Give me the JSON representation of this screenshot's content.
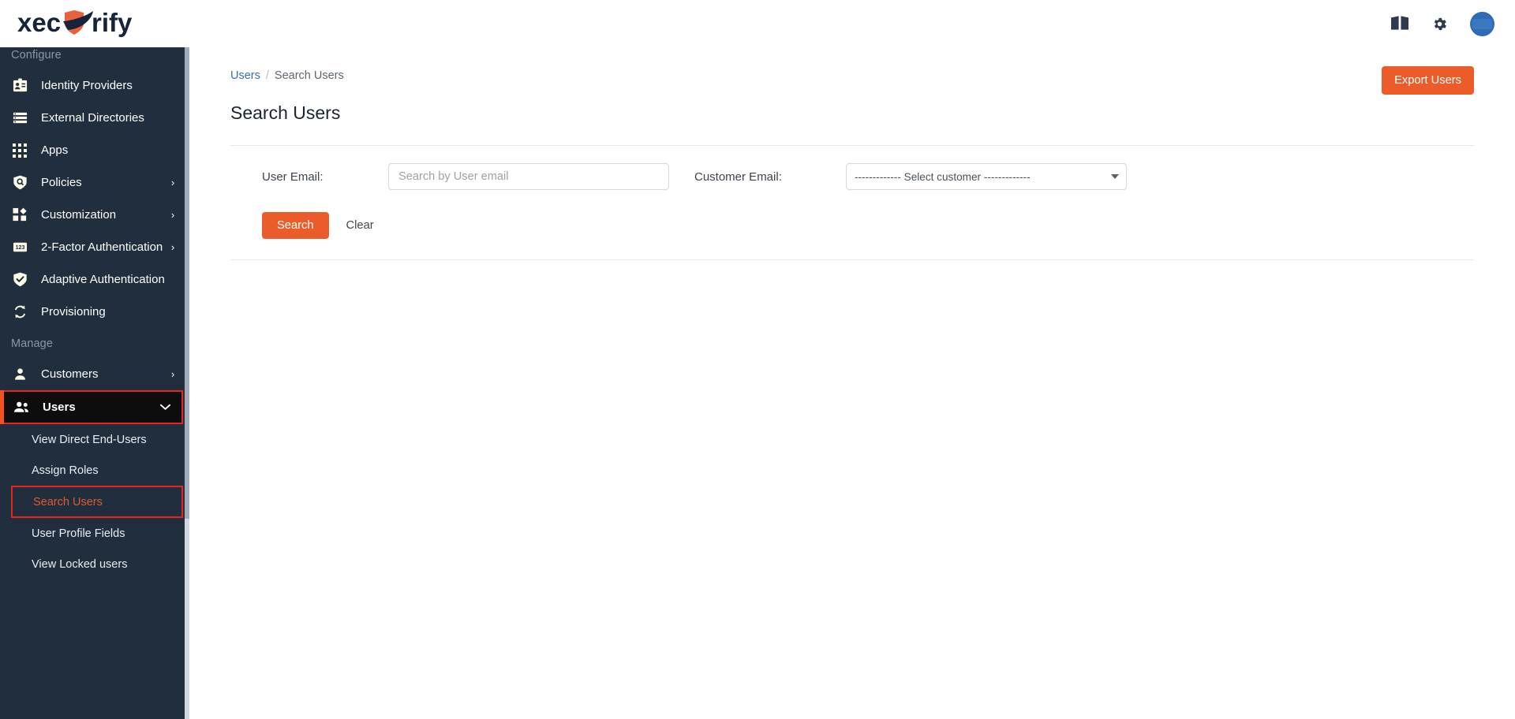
{
  "topbar": {
    "logo_text": "xecurify",
    "icons": [
      {
        "name": "book-icon",
        "label": "Documentation"
      },
      {
        "name": "gear-icon",
        "label": "Settings"
      },
      {
        "name": "avatar",
        "label": "Account",
        "color": "#2e6bb3"
      }
    ]
  },
  "sidebar": {
    "sections": [
      {
        "label": "Configure",
        "items": [
          {
            "label": "Identity Providers",
            "icon": "id-badge-icon",
            "chevron": ""
          },
          {
            "label": "External Directories",
            "icon": "list-icon",
            "chevron": ""
          },
          {
            "label": "Apps",
            "icon": "grid-icon",
            "chevron": ""
          },
          {
            "label": "Policies",
            "icon": "shield-search-icon",
            "chevron": "›"
          },
          {
            "label": "Customization",
            "icon": "blocks-icon",
            "chevron": "›"
          },
          {
            "label": "2-Factor Authentication",
            "icon": "123-icon",
            "chevron": "›"
          },
          {
            "label": "Adaptive Authentication",
            "icon": "shield-check-icon",
            "chevron": ""
          },
          {
            "label": "Provisioning",
            "icon": "sync-icon",
            "chevron": ""
          }
        ]
      },
      {
        "label": "Manage",
        "items": [
          {
            "label": "Customers",
            "icon": "user-icon",
            "chevron": "›"
          },
          {
            "label": "Users",
            "icon": "users-icon",
            "chevron": "⌄",
            "active": true
          }
        ]
      }
    ],
    "subitems": [
      {
        "label": "View Direct End-Users",
        "selected": false
      },
      {
        "label": "Assign Roles",
        "selected": false
      },
      {
        "label": "Search Users",
        "selected": true
      },
      {
        "label": "User Profile Fields",
        "selected": false
      },
      {
        "label": "View Locked users",
        "selected": false
      }
    ],
    "colors": {
      "background": "#202e3d",
      "active_background": "#0d0d0d",
      "highlight_border": "#e8241b",
      "accent_bar": "#f4511e",
      "selected_text": "#e05a2b"
    }
  },
  "main": {
    "breadcrumb": {
      "parent": "Users",
      "separator": "/",
      "current": "Search Users"
    },
    "page_title": "Search Users",
    "export_button": "Export Users",
    "form": {
      "user_email_label": "User Email:",
      "user_email_value": "",
      "user_email_placeholder": "Search by User email",
      "customer_email_label": "Customer Email:",
      "customer_select_value": "------------- Select customer -------------",
      "search_button": "Search",
      "clear_button": "Clear"
    },
    "colors": {
      "primary": "#ec5c2a",
      "link": "#3b6ea5",
      "text": "#3c454f"
    }
  }
}
